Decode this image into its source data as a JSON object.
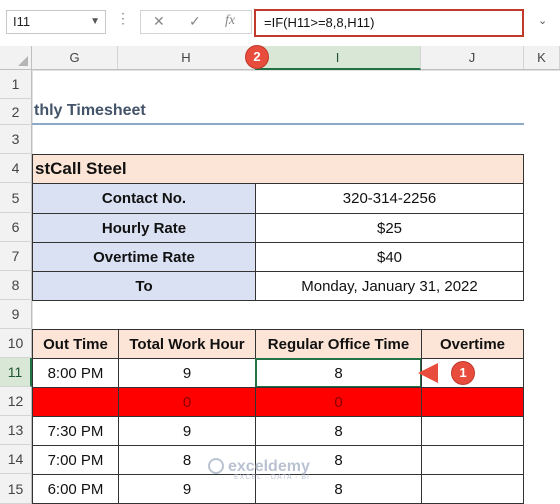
{
  "formula_bar": {
    "name_box": "I11",
    "cancel_icon": "✕",
    "enter_icon": "✓",
    "fx_label": "fx",
    "formula": "=IF(H11>=8,8,H11)"
  },
  "columns": [
    "G",
    "H",
    "I",
    "J",
    "K"
  ],
  "rows": [
    "1",
    "2",
    "3",
    "4",
    "5",
    "6",
    "7",
    "8",
    "9",
    "10",
    "11",
    "12",
    "13",
    "14",
    "15"
  ],
  "sheet": {
    "title": "thly Timesheet",
    "company": "stCall Steel",
    "info": [
      {
        "label": "Contact No.",
        "value": "320-314-2256"
      },
      {
        "label": "Hourly Rate",
        "value": "$25"
      },
      {
        "label": "Overtime Rate",
        "value": "$40"
      },
      {
        "label": "To",
        "value": "Monday, January 31, 2022"
      }
    ],
    "table_headers": [
      "Out Time",
      "Total Work Hour",
      "Regular Office Time",
      "Overtime"
    ],
    "table_rows": [
      {
        "out_time": "8:00 PM",
        "total": "9",
        "regular": "8",
        "overtime": ""
      },
      {
        "out_time": "",
        "total": "0",
        "regular": "0",
        "overtime": ""
      },
      {
        "out_time": "7:30 PM",
        "total": "9",
        "regular": "8",
        "overtime": ""
      },
      {
        "out_time": "7:00 PM",
        "total": "8",
        "regular": "8",
        "overtime": ""
      },
      {
        "out_time": "6:00 PM",
        "total": "9",
        "regular": "8",
        "overtime": ""
      }
    ]
  },
  "annotations": {
    "badge_1": "1",
    "badge_2": "2"
  },
  "watermark": {
    "name": "exceldemy",
    "tagline": "EXCEL · DATA · BI"
  },
  "colors": {
    "accent_green": "#217346",
    "highlight_red": "#ff0000",
    "annotation_red": "#e74c3c",
    "header_peach": "#fce4d6",
    "label_blue": "#d9e1f2"
  }
}
